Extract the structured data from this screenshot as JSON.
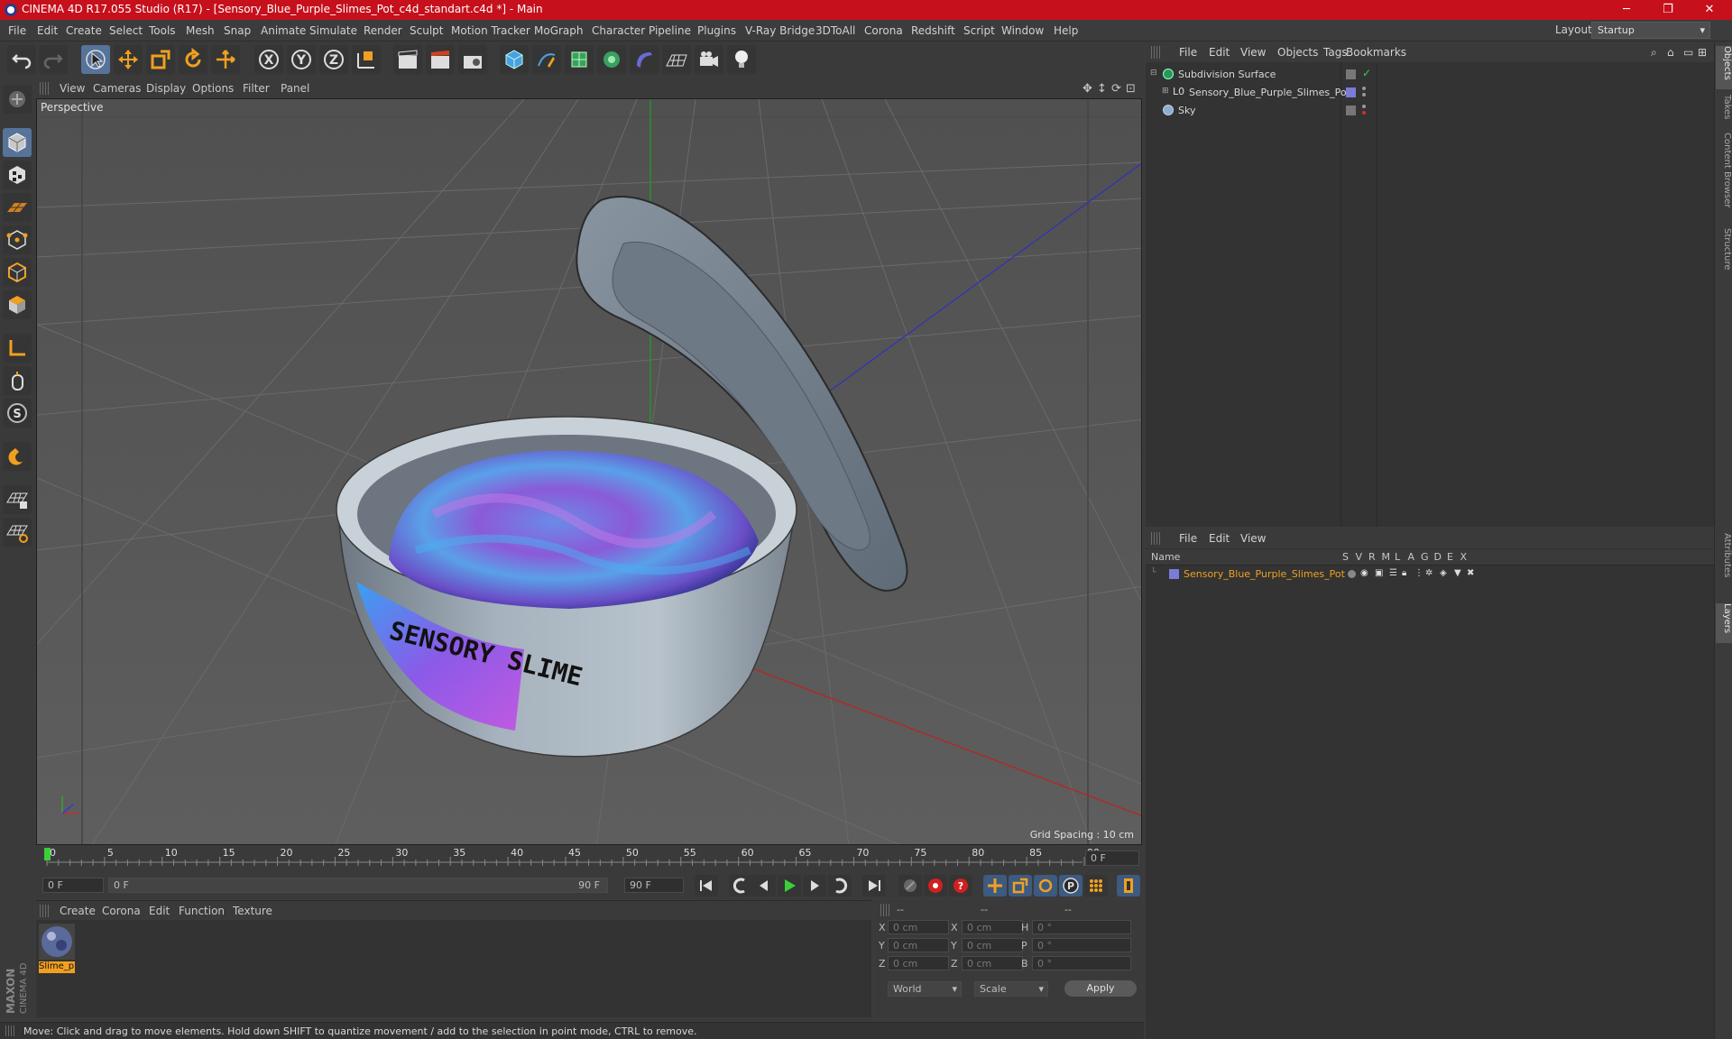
{
  "window": {
    "title": "CINEMA 4D R17.055 Studio (R17) - [Sensory_Blue_Purple_Slimes_Pot_c4d_standart.c4d *] - Main",
    "minimize": "─",
    "maximize": "❐",
    "close": "✕"
  },
  "menubar": {
    "items": [
      "File",
      "Edit",
      "Create",
      "Select",
      "Tools",
      "Mesh",
      "Snap",
      "Animate",
      "Simulate",
      "Render",
      "Sculpt",
      "Motion Tracker",
      "MoGraph",
      "Character",
      "Pipeline",
      "Plugins",
      "V-Ray Bridge",
      "3DToAll",
      "Corona",
      "Redshift",
      "Script",
      "Window",
      "Help"
    ],
    "layout_label": "Layout:",
    "layout_value": "Startup"
  },
  "viewport": {
    "menu": [
      "View",
      "Cameras",
      "Display",
      "Options",
      "Filter",
      "Panel"
    ],
    "label": "Perspective",
    "grid_spacing": "Grid Spacing : 10 cm",
    "label_text": "SENSORY SLIME"
  },
  "timeline": {
    "ticks": [
      "0",
      "5",
      "10",
      "15",
      "20",
      "25",
      "30",
      "35",
      "40",
      "45",
      "50",
      "55",
      "60",
      "65",
      "70",
      "75",
      "80",
      "85",
      "90"
    ],
    "current_frame": "0 F",
    "start_field": "0 F",
    "range_start": "0 F",
    "range_end": "90 F",
    "end_field": "90 F"
  },
  "material_manager": {
    "menu": [
      "Create",
      "Corona",
      "Edit",
      "Function",
      "Texture"
    ],
    "materials": [
      {
        "name": "Slime_p"
      }
    ]
  },
  "coordinates": {
    "headers": [
      "--",
      "--",
      "--"
    ],
    "rows": [
      {
        "a": "X",
        "av": "0 cm",
        "b": "X",
        "bv": "0 cm",
        "c": "H",
        "cv": "0 °"
      },
      {
        "a": "Y",
        "av": "0 cm",
        "b": "Y",
        "bv": "0 cm",
        "c": "P",
        "cv": "0 °"
      },
      {
        "a": "Z",
        "av": "0 cm",
        "b": "Z",
        "bv": "0 cm",
        "c": "B",
        "cv": "0 °"
      }
    ],
    "mode1": "World",
    "mode2": "Scale",
    "apply": "Apply"
  },
  "object_manager": {
    "menu": [
      "File",
      "Edit",
      "View",
      "Objects",
      "Tags",
      "Bookmarks"
    ],
    "objects": [
      {
        "name": "Subdivision Surface"
      },
      {
        "name": "Sensory_Blue_Purple_Slimes_Pot"
      },
      {
        "name": "Sky"
      }
    ]
  },
  "layer_manager": {
    "menu": [
      "File",
      "Edit",
      "View"
    ],
    "name_header": "Name",
    "columns": [
      "S",
      "V",
      "R",
      "M",
      "L",
      "A",
      "G",
      "D",
      "E",
      "X"
    ],
    "layers": [
      {
        "name": "Sensory_Blue_Purple_Slimes_Pot",
        "color": "#7b7bd8"
      }
    ]
  },
  "side_tabs": [
    "Objects",
    "Takes",
    "Content Browser",
    "Structure",
    "Attributes",
    "Layers"
  ],
  "status": "Move: Click and drag to move elements. Hold down SHIFT to quantize movement / add to the selection in point mode, CTRL to remove.",
  "brand": "MAXON CINEMA 4D",
  "colors": {
    "accent": "#c6101c",
    "selection": "#f0a020",
    "active_tool": "#56739a"
  }
}
